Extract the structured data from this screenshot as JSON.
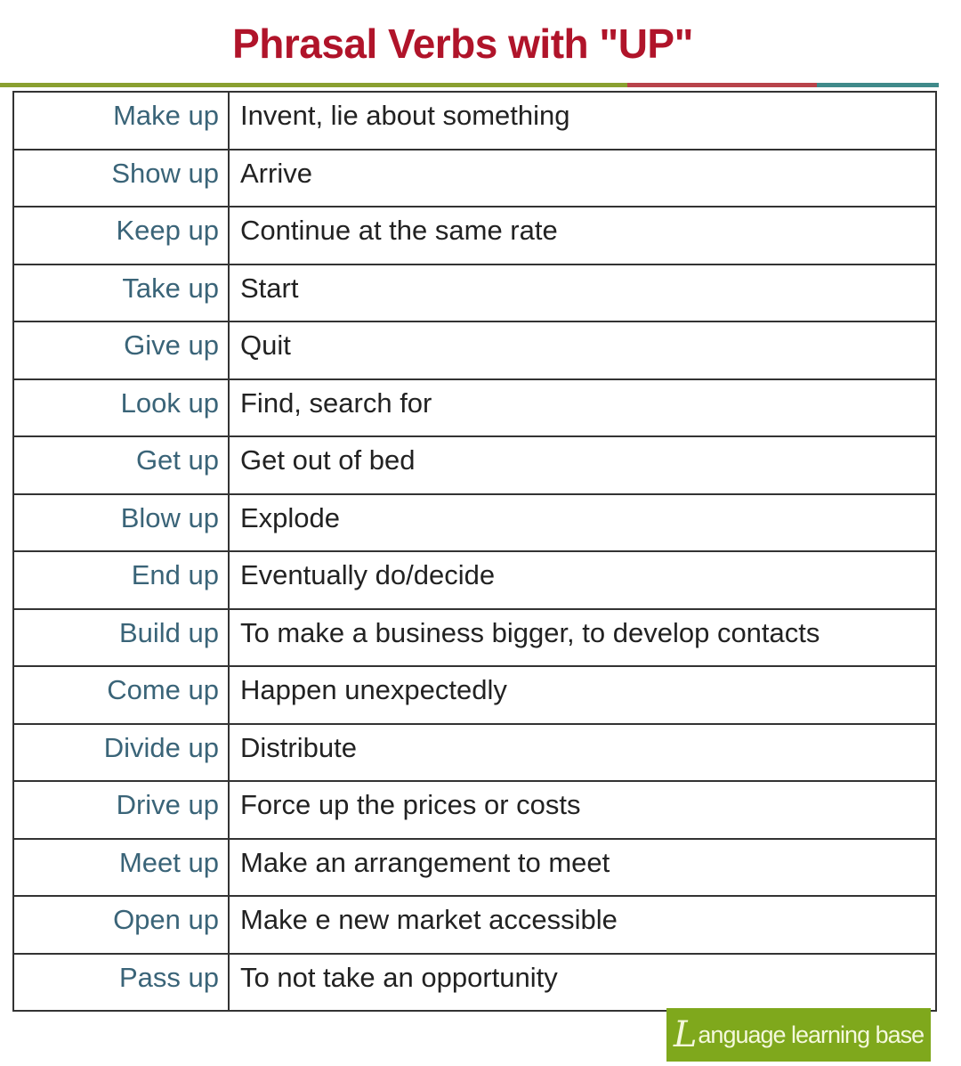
{
  "title": "Phrasal Verbs with \"UP\"",
  "colors": {
    "title": "#b0142a",
    "verb": "#3a6478",
    "rule_green": "#8aa030",
    "rule_red": "#b8434a",
    "rule_teal": "#3f8a8a",
    "logo_bg": "#7fa81c"
  },
  "rows": [
    {
      "verb": "Make up",
      "definition": "Invent, lie about something"
    },
    {
      "verb": "Show up",
      "definition": "Arrive"
    },
    {
      "verb": "Keep up",
      "definition": "Continue at the same rate"
    },
    {
      "verb": "Take up",
      "definition": "Start"
    },
    {
      "verb": "Give up",
      "definition": "Quit"
    },
    {
      "verb": "Look up",
      "definition": "Find, search for"
    },
    {
      "verb": "Get up",
      "definition": "Get out of bed"
    },
    {
      "verb": "Blow up",
      "definition": "Explode"
    },
    {
      "verb": "End up",
      "definition": "Eventually do/decide"
    },
    {
      "verb": "Build up",
      "definition": "To make a business bigger, to develop contacts"
    },
    {
      "verb": "Come up",
      "definition": "Happen unexpectedly"
    },
    {
      "verb": "Divide up",
      "definition": "Distribute"
    },
    {
      "verb": "Drive up",
      "definition": "Force up the prices or costs"
    },
    {
      "verb": "Meet up",
      "definition": "Make an arrangement to meet"
    },
    {
      "verb": "Open up",
      "definition": "Make e new market accessible"
    },
    {
      "verb": "Pass up",
      "definition": "To not take an opportunity"
    }
  ],
  "logo": {
    "initial": "L",
    "text": "anguage learning base"
  }
}
